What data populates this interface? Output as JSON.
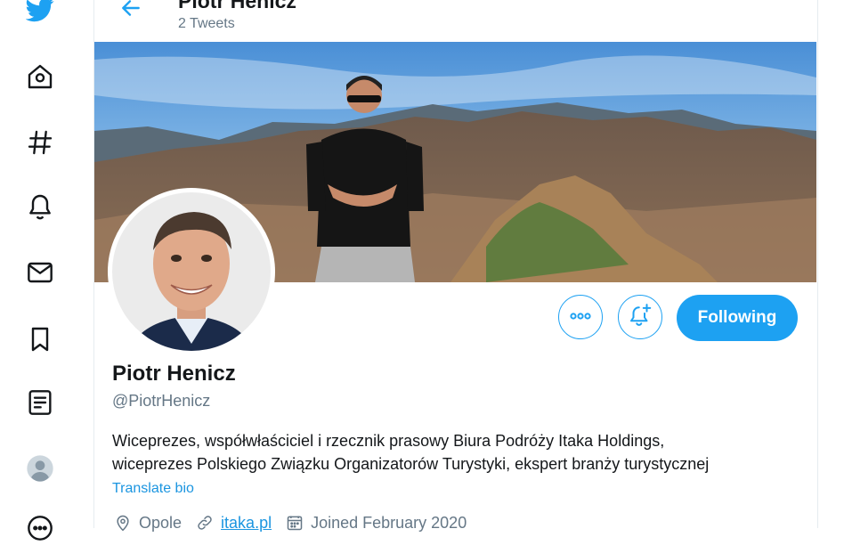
{
  "colors": {
    "accent": "#1da1f2",
    "link": "#1b95e0",
    "text": "#14171a",
    "muted": "#657786",
    "nav_icon": "#14171a"
  },
  "nav": {
    "items": [
      {
        "name": "twitter-logo-icon"
      },
      {
        "name": "home-icon"
      },
      {
        "name": "explore-hashtag-icon"
      },
      {
        "name": "notifications-bell-icon"
      },
      {
        "name": "messages-envelope-icon"
      },
      {
        "name": "bookmarks-icon"
      },
      {
        "name": "lists-icon"
      },
      {
        "name": "profile-avatar-icon"
      },
      {
        "name": "more-circle-icon"
      }
    ]
  },
  "header": {
    "title": "Piotr Henicz",
    "tweet_count": "2 Tweets",
    "back_icon": "arrow-left-icon"
  },
  "profile": {
    "display_name": "Piotr Henicz",
    "handle": "@PiotrHenicz",
    "bio_lines": [
      "Wiceprezes, współwłaściciel i rzecznik prasowy Biura Podróży Itaka Holdings,",
      "wiceprezes Polskiego Związku Organizatorów Turystyki, ekspert branży turystycznej"
    ],
    "translate_label": "Translate bio",
    "location": "Opole",
    "website": "itaka.pl",
    "joined": "Joined February 2020"
  },
  "actions": {
    "more_icon": "more-dots-icon",
    "notify_icon": "bell-plus-icon",
    "following_label": "Following"
  }
}
